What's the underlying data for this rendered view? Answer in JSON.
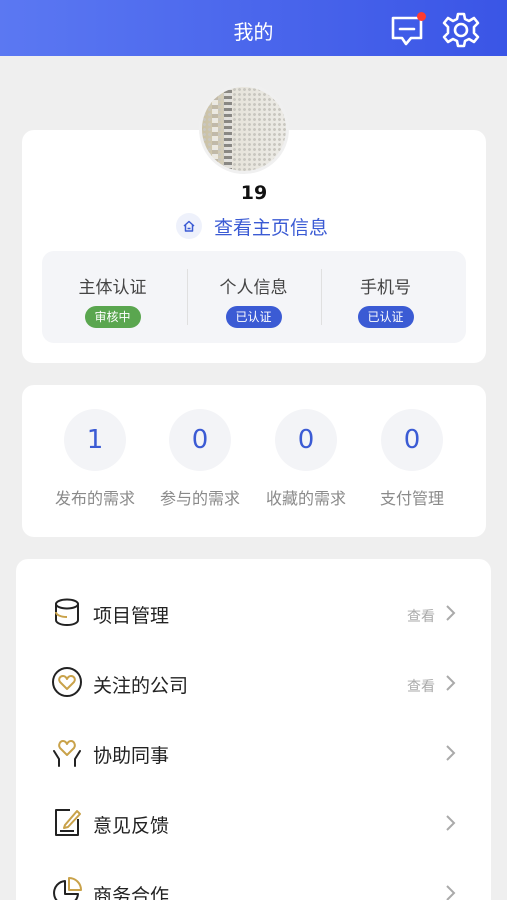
{
  "header": {
    "title": "我的"
  },
  "profile": {
    "username": "19",
    "home_link": "查看主页信息",
    "certifications": [
      {
        "label": "主体认证",
        "status": "审核中",
        "color": "#5aa64f"
      },
      {
        "label": "个人信息",
        "status": "已认证",
        "color": "#3b5bd4"
      },
      {
        "label": "手机号",
        "status": "已认证",
        "color": "#3b5bd4"
      }
    ]
  },
  "stats": [
    {
      "value": "1",
      "label": "发布的需求"
    },
    {
      "value": "0",
      "label": "参与的需求"
    },
    {
      "value": "0",
      "label": "收藏的需求"
    },
    {
      "value": "0",
      "label": "支付管理"
    }
  ],
  "menu": [
    {
      "label": "项目管理",
      "hint": "查看",
      "icon": "database-icon"
    },
    {
      "label": "关注的公司",
      "hint": "查看",
      "icon": "heart-circle-icon"
    },
    {
      "label": "协助同事",
      "hint": "",
      "icon": "heart-hands-icon"
    },
    {
      "label": "意见反馈",
      "hint": "",
      "icon": "feedback-edit-icon"
    },
    {
      "label": "商务合作",
      "hint": "",
      "icon": "pie-chart-icon"
    }
  ],
  "colors": {
    "accent": "#3b5bd4",
    "header_start": "#5b78f2",
    "header_end": "#3a55e6",
    "review": "#5aa64f"
  }
}
